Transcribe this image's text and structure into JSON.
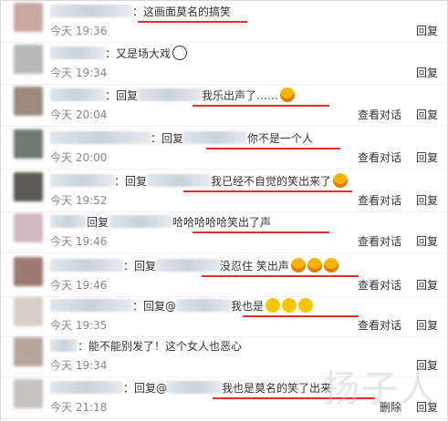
{
  "comments": [
    {
      "name_w": 90,
      "pre": "：",
      "reply_w": 0,
      "text": "这画面莫名的搞笑",
      "time": "今天 19:36",
      "actions": [
        "回复"
      ],
      "emoji": [],
      "red": [
        150,
        270
      ]
    },
    {
      "name_w": 60,
      "pre": "：",
      "reply_w": 0,
      "text": "又是场大戏",
      "time": "今天 19:34",
      "actions": [
        "回复"
      ],
      "emoji": [
        "panda"
      ],
      "red": null
    },
    {
      "name_w": 60,
      "pre": "：回复",
      "reply_w": 70,
      "text": "我乐出声了……",
      "time": "今天 20:04",
      "actions": [
        "查看对话",
        "回复"
      ],
      "emoji": [
        "laugh"
      ],
      "red": [
        210,
        360
      ]
    },
    {
      "name_w": 110,
      "pre": "：回复",
      "reply_w": 70,
      "text": "你不是一个人",
      "time": "今天 20:00",
      "actions": [
        "查看对话",
        "回复"
      ],
      "emoji": [],
      "red": [
        225,
        372
      ]
    },
    {
      "name_w": 70,
      "pre": "：回复",
      "reply_w": 70,
      "text": "我已经不自觉的笑出来了",
      "time": "今天 19:52",
      "actions": [
        "查看对话",
        "回复"
      ],
      "emoji": [
        "laugh"
      ],
      "red": [
        200,
        385
      ]
    },
    {
      "name_w": 40,
      "pre": "回复",
      "reply_w": 70,
      "text": "哈哈哈哈哈笑出了声",
      "time": "今天 19:46",
      "actions": [
        "查看对话",
        "回复"
      ],
      "emoji": [],
      "red": [
        210,
        360
      ]
    },
    {
      "name_w": 80,
      "pre": "：回复",
      "reply_w": 70,
      "text": "没忍住 笑出声",
      "time": "今天 19:46",
      "actions": [
        "查看对话",
        "回复"
      ],
      "emoji": [
        "laugh",
        "laugh",
        "laugh"
      ],
      "red": [
        220,
        392
      ]
    },
    {
      "name_w": 90,
      "pre": "：回复@",
      "reply_w": 60,
      "text": "我也是",
      "time": "今天 19:35",
      "actions": [
        "查看对话",
        "回复"
      ],
      "emoji": [
        "cry",
        "cry",
        "cry"
      ],
      "red": [
        265,
        392
      ]
    },
    {
      "name_w": 30,
      "pre": "：",
      "reply_w": 0,
      "text": "能不能别发了！这个女人也恶心",
      "time": "今天 19:34",
      "actions": [
        "回复"
      ],
      "emoji": [],
      "red": null
    },
    {
      "name_w": 80,
      "pre": "：回复@",
      "reply_w": 60,
      "text": "我也是莫名的笑了出来",
      "time": "今天 21:18",
      "actions": [
        "删除",
        "回复"
      ],
      "emoji": [],
      "red": [
        232,
        410
      ]
    }
  ],
  "watermark": "扬子人"
}
